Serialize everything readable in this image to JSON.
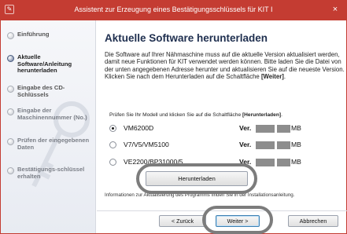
{
  "window": {
    "title": "Assistent zur Erzeugung eines Bestätigungsschlüssels für KIT I",
    "close_glyph": "×"
  },
  "sidebar": {
    "steps": [
      {
        "label": "Einführung",
        "state": "done"
      },
      {
        "label": "Aktuelle Software/Anleitung herunterladen",
        "state": "active"
      },
      {
        "label": "Eingabe des CD-Schlüssels",
        "state": "pending"
      },
      {
        "label": "Eingabe der Maschinennummer (No.)",
        "state": "pending"
      },
      {
        "label": "Prüfen der eingegebenen Daten",
        "state": "pending"
      },
      {
        "label": "Bestätigungs-schlüssel erhalten",
        "state": "pending"
      }
    ]
  },
  "main": {
    "heading": "Aktuelle Software herunterladen",
    "description_part1": "Die Software auf Ihrer Nähmaschine muss auf die aktuelle Version aktualisiert werden, damit neue Funktionen für KIT verwendet werden können. Bitte laden Sie die Datei von der unten angegebenen Adresse herunter und aktualisieren Sie auf die neueste Version. Klicken Sie nach dem Herunterladen auf die Schaltfläche ",
    "description_bold": "[Weiter]",
    "description_end": ".",
    "instruction_part1": "Prüfen Sie Ihr Modell und klicken Sie auf die Schaltfläche ",
    "instruction_bold": "[Herunterladen]",
    "instruction_end": ".",
    "models": [
      {
        "name": "VM6200D",
        "selected": true,
        "ver_label": "Ver.",
        "unit": "MB"
      },
      {
        "name": "V7/V5/VM5100",
        "selected": false,
        "ver_label": "Ver.",
        "unit": "MB"
      },
      {
        "name": "VE2200/BP31000/5...",
        "selected": false,
        "ver_label": "Ver.",
        "unit": "MB"
      }
    ],
    "download_button": "Herunterladen",
    "note": "Informationen zur Aktualisierung des Programms finden Sie in der Installationsanleitung."
  },
  "footer": {
    "back_label": "< Zurück",
    "next_label": "Weiter >",
    "cancel_label": "Abbrechen"
  },
  "colors": {
    "titlebar": "#c43c32",
    "heading": "#1f2f4f",
    "highlight_ring": "#7c7c7c"
  }
}
